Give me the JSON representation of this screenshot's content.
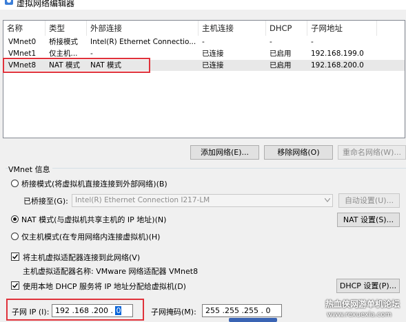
{
  "window": {
    "title": "虚拟网络编辑器"
  },
  "list": {
    "columns": [
      "名称",
      "类型",
      "外部连接",
      "主机连接",
      "DHCP",
      "子网地址"
    ],
    "rows": [
      {
        "name": "VMnet0",
        "type": "桥接模式",
        "external": "Intel(R) Ethernet Connectio...",
        "host": "-",
        "dhcp": "-",
        "subnet": "-"
      },
      {
        "name": "VMnet1",
        "type": "仅主机...",
        "external": "-",
        "host": "已连接",
        "dhcp": "已启用",
        "subnet": "192.168.199.0"
      },
      {
        "name": "VMnet8",
        "type": "NAT 模式",
        "external": "NAT 模式",
        "host": "已连接",
        "dhcp": "已启用",
        "subnet": "192.168.200.0"
      }
    ]
  },
  "actions": {
    "add": "添加网络(E)...",
    "remove": "移除网络(O)",
    "rename": "重命名网络(W)..."
  },
  "info": {
    "title": "VMnet 信息",
    "bridged_label": "桥接模式(将虚拟机直接连接到外部网络)(B)",
    "bridged_to_label": "已桥接至(G):",
    "bridged_to_value": "Intel(R) Ethernet Connection I217-LM",
    "auto_settings": "自动设置(U)...",
    "nat_label": "NAT 模式(与虚拟机共享主机的 IP 地址)(N)",
    "nat_settings": "NAT 设置(S)...",
    "hostonly_label": "仅主机模式(在专用网络内连接虚拟机)(H)",
    "connect_adapter_label": "将主机虚拟适配器连接到此网络(V)",
    "adapter_name_line": "主机虚拟适配器名称: VMware 网络适配器 VMnet8",
    "dhcp_label": "使用本地 DHCP 服务将 IP 地址分配给虚拟机(D)",
    "dhcp_settings": "DHCP 设置(P)...",
    "subnet_ip_label": "子网 IP (I):",
    "subnet_ip_prefix": "192 .168 .200 . ",
    "subnet_ip_last": "0",
    "subnet_mask_label": "子网掩码(M):",
    "subnet_mask_value": "255 .255 .255 . 0"
  },
  "watermark": {
    "line1": "热血侠网游单机论坛",
    "line2": "www.rexuexia.com"
  },
  "colors": {
    "highlight_box": "#e0313a",
    "selected_row": "#e8e8e8"
  }
}
